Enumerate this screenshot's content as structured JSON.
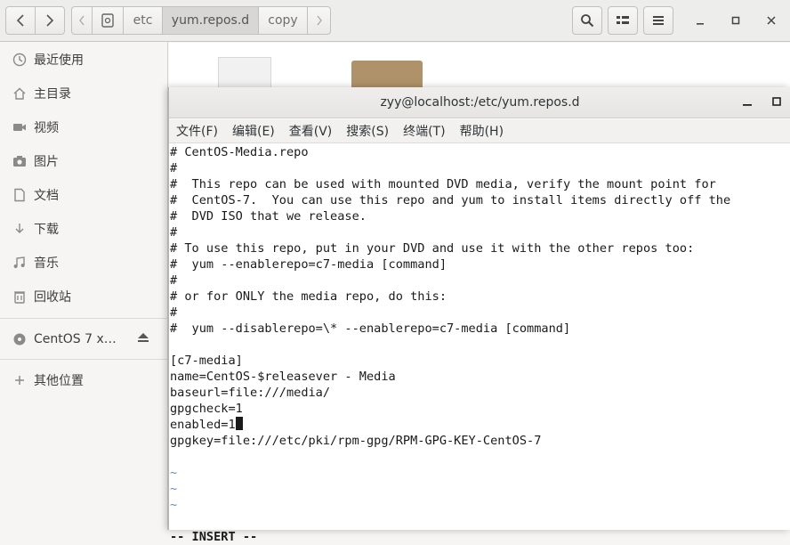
{
  "file_manager": {
    "breadcrumbs": [
      "etc",
      "yum.repos.d",
      "copy"
    ],
    "sidebar": {
      "items": [
        {
          "label": "最近使用",
          "icon": "clock-icon"
        },
        {
          "label": "主目录",
          "icon": "home-icon"
        },
        {
          "label": "视频",
          "icon": "video-icon"
        },
        {
          "label": "图片",
          "icon": "camera-icon"
        },
        {
          "label": "文档",
          "icon": "document-icon"
        },
        {
          "label": "下载",
          "icon": "download-icon"
        },
        {
          "label": "音乐",
          "icon": "music-icon"
        },
        {
          "label": "回收站",
          "icon": "trash-icon"
        }
      ],
      "device": {
        "label": "CentOS 7 x…",
        "icon": "disc-icon"
      },
      "other": {
        "label": "其他位置",
        "icon": "plus-icon"
      }
    }
  },
  "terminal": {
    "title": "zyy@localhost:/etc/yum.repos.d",
    "menu": [
      "文件(F)",
      "编辑(E)",
      "查看(V)",
      "搜索(S)",
      "终端(T)",
      "帮助(H)"
    ],
    "lines": [
      "# CentOS-Media.repo",
      "#",
      "#  This repo can be used with mounted DVD media, verify the mount point for",
      "#  CentOS-7.  You can use this repo and yum to install items directly off the",
      "#  DVD ISO that we release.",
      "#",
      "# To use this repo, put in your DVD and use it with the other repos too:",
      "#  yum --enablerepo=c7-media [command]",
      "#",
      "# or for ONLY the media repo, do this:",
      "#",
      "#  yum --disablerepo=\\* --enablerepo=c7-media [command]",
      "",
      "[c7-media]",
      "name=CentOS-$releasever - Media",
      "baseurl=file:///media/",
      "gpgcheck=1",
      "enabled=1",
      "gpgkey=file:///etc/pki/rpm-gpg/RPM-GPG-KEY-CentOS-7",
      ""
    ],
    "tildes": [
      "~",
      "~",
      "~"
    ],
    "mode": "-- INSERT --"
  }
}
